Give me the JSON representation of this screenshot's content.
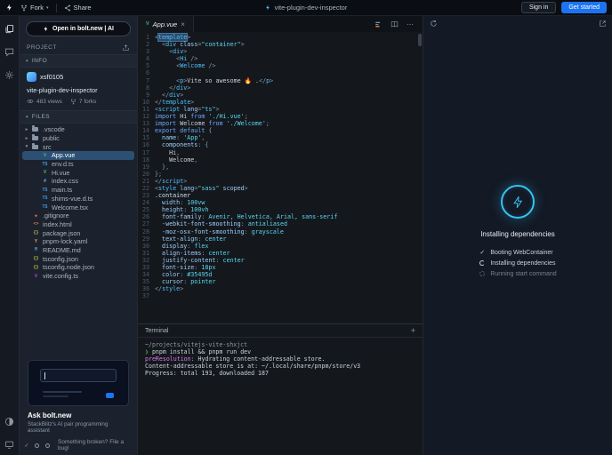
{
  "topbar": {
    "fork": "Fork",
    "share": "Share",
    "title": "vite-plugin-dev-inspector",
    "sign_in": "Sign in",
    "get_started": "Get started"
  },
  "sidebar": {
    "open_in_bolt": "Open in bolt.new | AI",
    "project": "PROJECT",
    "info": "INFO",
    "username": "xsf0105",
    "project_name": "vite-plugin-dev-inspector",
    "views": "483 views",
    "forks": "7 forks",
    "files": "FILES",
    "tree": [
      {
        "label": ".vscode",
        "kind": "folder",
        "depth": 0
      },
      {
        "label": "public",
        "kind": "folder",
        "depth": 0
      },
      {
        "label": "src",
        "kind": "folder-open",
        "depth": 0
      },
      {
        "label": "App.vue",
        "kind": "vue",
        "depth": 1,
        "selected": true
      },
      {
        "label": "env.d.ts",
        "kind": "ts",
        "depth": 1
      },
      {
        "label": "Hi.vue",
        "kind": "vue",
        "depth": 1
      },
      {
        "label": "index.css",
        "kind": "css",
        "depth": 1
      },
      {
        "label": "main.ts",
        "kind": "ts",
        "depth": 1
      },
      {
        "label": "shims-vue.d.ts",
        "kind": "ts",
        "depth": 1
      },
      {
        "label": "Welcome.tsx",
        "kind": "tsx",
        "depth": 1
      },
      {
        "label": ".gitignore",
        "kind": "git",
        "depth": 0
      },
      {
        "label": "index.html",
        "kind": "html",
        "depth": 0
      },
      {
        "label": "package.json",
        "kind": "json",
        "depth": 0
      },
      {
        "label": "pnpm-lock.yaml",
        "kind": "yaml",
        "depth": 0
      },
      {
        "label": "README.md",
        "kind": "md",
        "depth": 0
      },
      {
        "label": "tsconfig.json",
        "kind": "json",
        "depth": 0
      },
      {
        "label": "tsconfig.node.json",
        "kind": "json",
        "depth": 0
      },
      {
        "label": "vite.config.ts",
        "kind": "vite",
        "depth": 0
      }
    ],
    "promo_title": "Ask bolt.new",
    "promo_sub": "StackBlitz's AI pair programming assistant",
    "bug_link": "Something broken? File a bug!"
  },
  "icons": {
    "caret": "▾",
    "section_chevron": "▾",
    "folder_closed": "▸",
    "folder_open": "▾",
    "kebab": "⋯",
    "plus": "+",
    "close": "×",
    "check": "✓"
  },
  "file_icons": {
    "vue": [
      "V",
      "#42b883"
    ],
    "ts": [
      "TS",
      "#4a9df8"
    ],
    "tsx": [
      "TS",
      "#4a9df8"
    ],
    "css": [
      "#",
      "#519aba"
    ],
    "git": [
      "◆",
      "#e8694c"
    ],
    "html": [
      "<>",
      "#e37933"
    ],
    "json": [
      "{}",
      "#cbcb41"
    ],
    "yaml": [
      "Y",
      "#e8a94c"
    ],
    "md": [
      "M",
      "#519aba"
    ],
    "vite": [
      "V",
      "#bd34fe"
    ]
  },
  "editor": {
    "tab": "App.vue",
    "lines": [
      [
        [
          "pun",
          "<"
        ],
        [
          "sel",
          "template"
        ],
        [
          "pun",
          ">"
        ]
      ],
      [
        [
          "pun",
          "  <"
        ],
        [
          "tag",
          "div"
        ],
        [
          "pln",
          " "
        ],
        [
          "attr",
          "class"
        ],
        [
          "pun",
          "="
        ],
        [
          "str",
          "\"container\""
        ],
        [
          "pun",
          ">"
        ]
      ],
      [
        [
          "pun",
          "    <"
        ],
        [
          "tag",
          "div"
        ],
        [
          "pun",
          ">"
        ]
      ],
      [
        [
          "pun",
          "      <"
        ],
        [
          "cmp",
          "Hi"
        ],
        [
          "pun",
          " />"
        ]
      ],
      [
        [
          "pun",
          "      <"
        ],
        [
          "cmp",
          "Welcome"
        ],
        [
          "pun",
          " />"
        ]
      ],
      [],
      [
        [
          "pun",
          "      <"
        ],
        [
          "tag",
          "p"
        ],
        [
          "pun",
          ">"
        ],
        [
          "pln",
          "Vite so awesome 🔥 ."
        ],
        [
          "pun",
          "</"
        ],
        [
          "tag",
          "p"
        ],
        [
          "pun",
          ">"
        ]
      ],
      [
        [
          "pun",
          "    </"
        ],
        [
          "tag",
          "div"
        ],
        [
          "pun",
          ">"
        ]
      ],
      [
        [
          "pun",
          "  </"
        ],
        [
          "tag",
          "div"
        ],
        [
          "pun",
          ">"
        ]
      ],
      [
        [
          "pun",
          "</"
        ],
        [
          "tag",
          "template"
        ],
        [
          "pun",
          ">"
        ]
      ],
      [
        [
          "pun",
          "<"
        ],
        [
          "tag",
          "script"
        ],
        [
          "pln",
          " "
        ],
        [
          "attr",
          "lang"
        ],
        [
          "pun",
          "="
        ],
        [
          "str",
          "\"ts\""
        ],
        [
          "pun",
          ">"
        ]
      ],
      [
        [
          "kw",
          "import"
        ],
        [
          "pln",
          " Hi "
        ],
        [
          "kw",
          "from"
        ],
        [
          "str",
          " './Hi.vue'"
        ],
        [
          "pun",
          ";"
        ]
      ],
      [
        [
          "kw",
          "import"
        ],
        [
          "pln",
          " Welcome "
        ],
        [
          "kw",
          "from"
        ],
        [
          "str",
          " './Welcome'"
        ],
        [
          "pun",
          ";"
        ]
      ],
      [
        [
          "kw",
          "export default"
        ],
        [
          "pun",
          " {"
        ]
      ],
      [
        [
          "prop",
          "  name"
        ],
        [
          "pun",
          ": "
        ],
        [
          "str",
          "'App'"
        ],
        [
          "pun",
          ","
        ]
      ],
      [
        [
          "prop",
          "  components"
        ],
        [
          "pun",
          ": {"
        ]
      ],
      [
        [
          "pln",
          "    Hi"
        ],
        [
          "pun",
          ","
        ]
      ],
      [
        [
          "pln",
          "    Welcome"
        ],
        [
          "pun",
          ","
        ]
      ],
      [
        [
          "pun",
          "  },"
        ]
      ],
      [
        [
          "pun",
          "};"
        ]
      ],
      [
        [
          "pun",
          "</"
        ],
        [
          "tag",
          "script"
        ],
        [
          "pun",
          ">"
        ]
      ],
      [
        [
          "pun",
          "<"
        ],
        [
          "tag",
          "style"
        ],
        [
          "pln",
          " "
        ],
        [
          "attr",
          "lang"
        ],
        [
          "pun",
          "="
        ],
        [
          "str",
          "\"sass\""
        ],
        [
          "pln",
          " "
        ],
        [
          "attr",
          "scoped"
        ],
        [
          "pun",
          ">"
        ]
      ],
      [
        [
          "cls",
          ".container"
        ]
      ],
      [
        [
          "prop",
          "  width"
        ],
        [
          "pun",
          ": "
        ],
        [
          "num",
          "100vw"
        ]
      ],
      [
        [
          "prop",
          "  height"
        ],
        [
          "pun",
          ": "
        ],
        [
          "num",
          "100vh"
        ]
      ],
      [
        [
          "prop",
          "  font-family"
        ],
        [
          "pun",
          ": "
        ],
        [
          "val",
          "Avenir, Helvetica, Arial, sans-serif"
        ]
      ],
      [
        [
          "prop",
          "  -webkit-font-smoothing"
        ],
        [
          "pun",
          ": "
        ],
        [
          "val",
          "antialiased"
        ]
      ],
      [
        [
          "prop",
          "  -moz-osx-font-smoothing"
        ],
        [
          "pun",
          ": "
        ],
        [
          "val",
          "grayscale"
        ]
      ],
      [
        [
          "prop",
          "  text-align"
        ],
        [
          "pun",
          ": "
        ],
        [
          "val",
          "center"
        ]
      ],
      [
        [
          "prop",
          "  display"
        ],
        [
          "pun",
          ": "
        ],
        [
          "val",
          "flex"
        ]
      ],
      [
        [
          "prop",
          "  align-items"
        ],
        [
          "pun",
          ": "
        ],
        [
          "val",
          "center"
        ]
      ],
      [
        [
          "prop",
          "  justify-content"
        ],
        [
          "pun",
          ": "
        ],
        [
          "val",
          "center"
        ]
      ],
      [
        [
          "prop",
          "  font-size"
        ],
        [
          "pun",
          ": "
        ],
        [
          "num",
          "18px"
        ]
      ],
      [
        [
          "prop",
          "  color"
        ],
        [
          "pun",
          ": "
        ],
        [
          "num",
          "#35495d"
        ]
      ],
      [
        [
          "prop",
          "  cursor"
        ],
        [
          "pun",
          ": "
        ],
        [
          "val",
          "pointer"
        ]
      ],
      [
        [
          "pun",
          "</"
        ],
        [
          "tag",
          "style"
        ],
        [
          "pun",
          ">"
        ]
      ],
      []
    ]
  },
  "terminal": {
    "title": "Terminal",
    "lines": [
      [
        [
          "dim",
          "~/projects/vitejs-vite-shxjct"
        ]
      ],
      [
        [
          "prompt",
          "❯"
        ],
        [
          "out",
          " pnpm install && pnpm run dev"
        ]
      ],
      [
        [
          "mag",
          "preResolution:"
        ],
        [
          "out",
          " Hydrating content-addressable store."
        ]
      ],
      [
        [
          "out",
          "Content-addressable store is at: ~/.local/share/pnpm/store/v3"
        ]
      ],
      [
        [
          "out",
          "Progress: total 193, downloaded 187"
        ]
      ]
    ]
  },
  "preview": {
    "title": "Installing dependencies",
    "steps": [
      {
        "state": "done",
        "label": "Booting WebContainer"
      },
      {
        "state": "active",
        "label": "Installing dependencies"
      },
      {
        "state": "pending",
        "label": "Running start command"
      }
    ]
  },
  "colors": {
    "accent_blue": "#1d74f2",
    "bolt_cyan": "#35c3f2",
    "vue_green": "#42b883"
  }
}
